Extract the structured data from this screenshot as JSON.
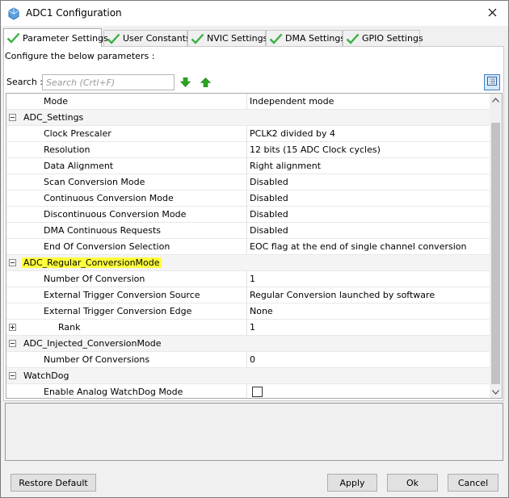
{
  "window": {
    "title": "ADC1 Configuration",
    "app_icon": "cube-icon",
    "close_icon": "close-icon"
  },
  "tabs": [
    {
      "label": "Parameter Settings",
      "active": true,
      "icon": "check-icon"
    },
    {
      "label": "User Constants",
      "active": false,
      "icon": "check-icon"
    },
    {
      "label": "NVIC Settings",
      "active": false,
      "icon": "check-icon"
    },
    {
      "label": "DMA Settings",
      "active": false,
      "icon": "check-icon"
    },
    {
      "label": "GPIO Settings",
      "active": false,
      "icon": "check-icon"
    }
  ],
  "configure_label": "Configure the below parameters :",
  "search": {
    "label": "Search :",
    "value": "",
    "placeholder": "Search (Crtl+F)",
    "down_icon": "arrow-down-icon",
    "up_icon": "arrow-up-icon",
    "list_icon": "list-view-icon"
  },
  "grid": {
    "rows": [
      {
        "kind": "prop",
        "name": "Mode",
        "value": "Independent mode"
      },
      {
        "kind": "cat",
        "name": "ADC_Settings",
        "expanded": true
      },
      {
        "kind": "prop",
        "name": "Clock Prescaler",
        "value": "PCLK2 divided by 4"
      },
      {
        "kind": "prop",
        "name": "Resolution",
        "value": "12 bits (15 ADC Clock cycles)"
      },
      {
        "kind": "prop",
        "name": "Data Alignment",
        "value": "Right alignment"
      },
      {
        "kind": "prop",
        "name": "Scan Conversion Mode",
        "value": "Disabled"
      },
      {
        "kind": "prop",
        "name": "Continuous Conversion Mode",
        "value": "Disabled"
      },
      {
        "kind": "prop",
        "name": "Discontinuous Conversion Mode",
        "value": "Disabled"
      },
      {
        "kind": "prop",
        "name": "DMA Continuous Requests",
        "value": "Disabled"
      },
      {
        "kind": "prop",
        "name": "End Of Conversion Selection",
        "value": "EOC flag at the end of single channel conversion"
      },
      {
        "kind": "cat",
        "name": "ADC_Regular_ConversionMode",
        "expanded": true,
        "highlight": true
      },
      {
        "kind": "prop",
        "name": "Number Of Conversion",
        "value": "1"
      },
      {
        "kind": "prop",
        "name": "External Trigger Conversion Source",
        "value": "Regular Conversion launched by software"
      },
      {
        "kind": "prop",
        "name": "External Trigger Conversion Edge",
        "value": "None"
      },
      {
        "kind": "subcat",
        "name": "Rank",
        "value": "1",
        "expanded": false
      },
      {
        "kind": "cat",
        "name": "ADC_Injected_ConversionMode",
        "expanded": true
      },
      {
        "kind": "prop",
        "name": "Number Of Conversions",
        "value": "0"
      },
      {
        "kind": "cat",
        "name": "WatchDog",
        "expanded": true
      },
      {
        "kind": "check",
        "name": "Enable Analog WatchDog Mode",
        "checked": false
      }
    ]
  },
  "buttons": {
    "restore_default": "Restore Default",
    "apply": "Apply",
    "ok": "Ok",
    "cancel": "Cancel"
  },
  "colors": {
    "highlight": "#ffff3c",
    "check_green": "#3cb043",
    "arrow_green": "#2aa520",
    "selected_blue": "#3d7fc2"
  }
}
